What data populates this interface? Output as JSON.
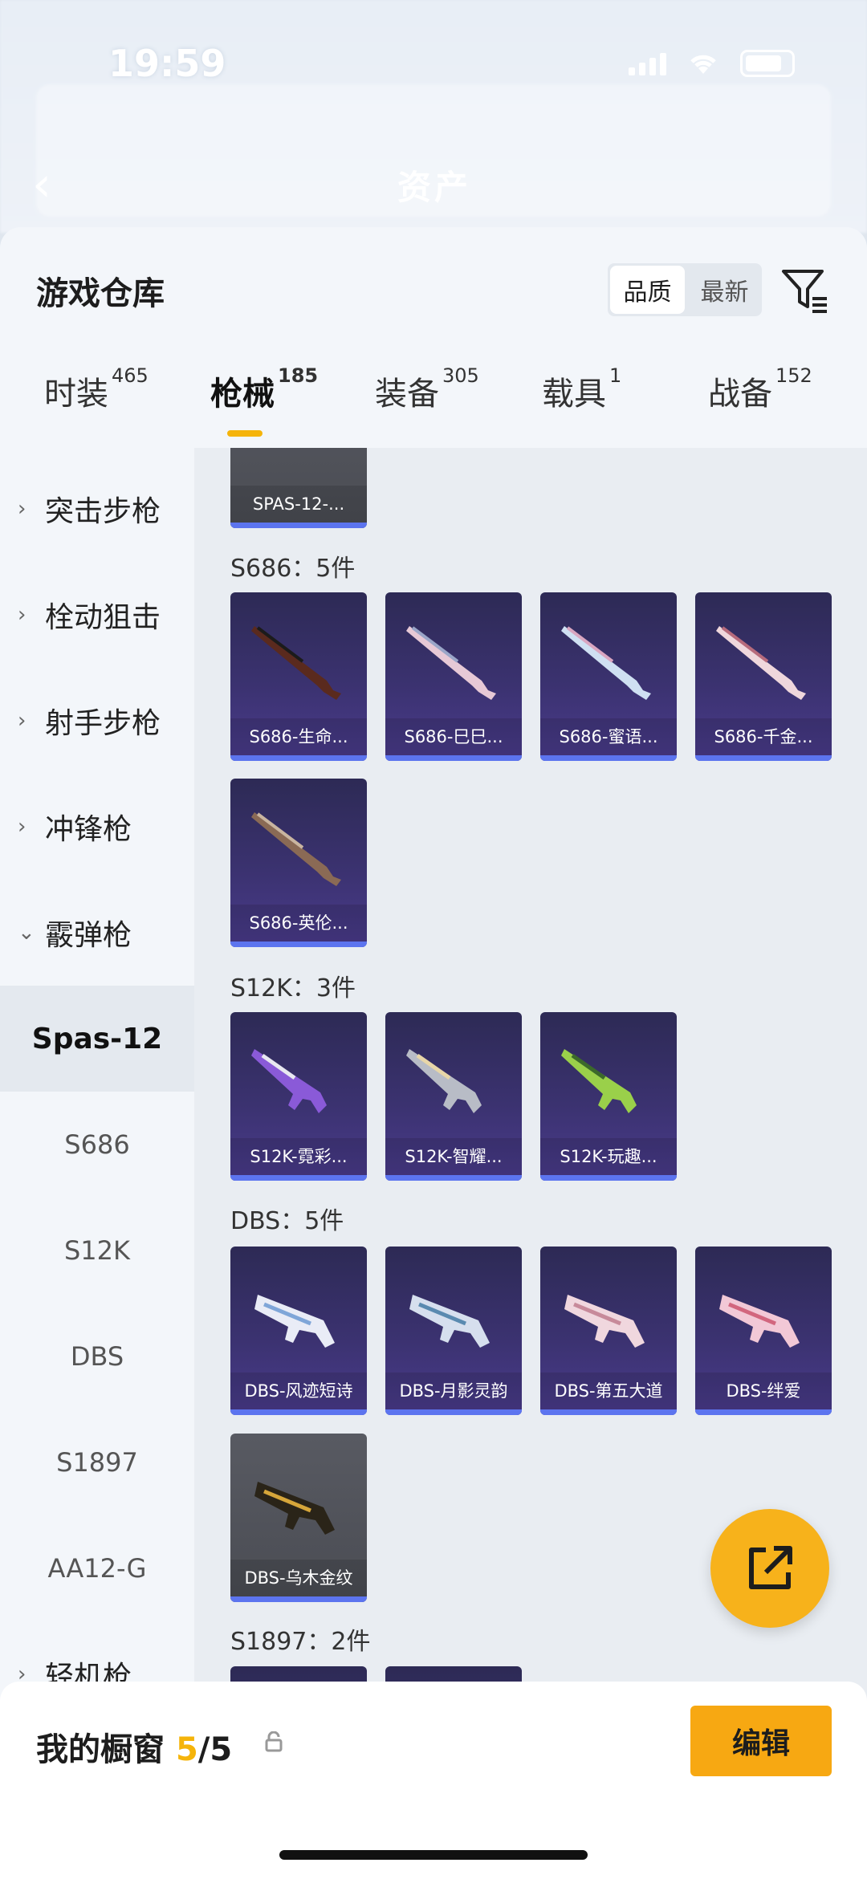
{
  "status_bar": {
    "time": "19:59"
  },
  "background": {
    "title": "资产"
  },
  "sheet": {
    "title": "游戏仓库",
    "sort": {
      "options": [
        "品质",
        "最新"
      ],
      "selected": "品质"
    }
  },
  "tabs": [
    {
      "label": "时装",
      "count": "465"
    },
    {
      "label": "枪械",
      "count": "185",
      "active": true
    },
    {
      "label": "装备",
      "count": "305"
    },
    {
      "label": "载具",
      "count": "1"
    },
    {
      "label": "战备",
      "count": "152"
    }
  ],
  "sidebar": {
    "categories": [
      {
        "label": "突击步枪",
        "chevron": "›"
      },
      {
        "label": "栓动狙击",
        "chevron": "›"
      },
      {
        "label": "射手步枪",
        "chevron": "›"
      },
      {
        "label": "冲锋枪",
        "chevron": "›"
      },
      {
        "label": "霰弹枪",
        "chevron": "⌄"
      }
    ],
    "subitems": [
      "Spas-12",
      "S686",
      "S12K",
      "DBS",
      "S1897",
      "AA12-G"
    ],
    "selected_subitem": "Spas-12",
    "after": {
      "label": "轻机枪",
      "chevron": "›"
    }
  },
  "content": {
    "top_partial_card": "SPAS-12-...",
    "groups": [
      {
        "header": "S686：5件",
        "items": [
          "S686-生命...",
          "S686-巳巳...",
          "S686-蜜语...",
          "S686-千金...",
          "S686-英伦..."
        ]
      },
      {
        "header": "S12K：3件",
        "items": [
          "S12K-霓彩...",
          "S12K-智耀...",
          "S12K-玩趣..."
        ]
      },
      {
        "header": "DBS：5件",
        "items": [
          "DBS-风迹短诗",
          "DBS-月影灵韵",
          "DBS-第五大道",
          "DBS-绊爱",
          "DBS-乌木金纹"
        ]
      },
      {
        "header": "S1897：2件",
        "items": []
      }
    ]
  },
  "bottom_bar": {
    "label": "我的橱窗",
    "count_current": "5",
    "count_total": "/5",
    "edit_label": "编辑"
  },
  "colors": {
    "accent": "#f5b40a",
    "card_bar": "#5c74ef",
    "card_bg": "#3b3270"
  }
}
